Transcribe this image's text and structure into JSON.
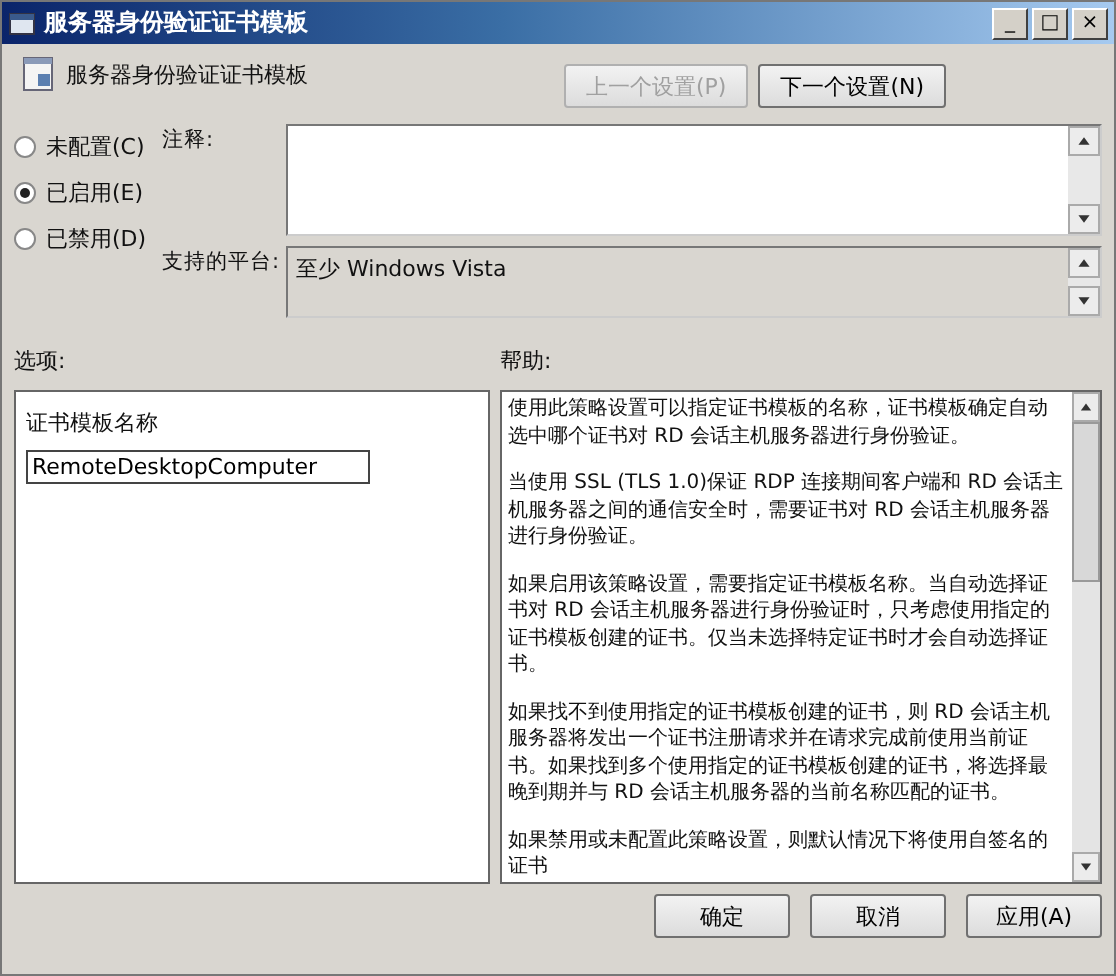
{
  "window": {
    "title": "服务器身份验证证书模板",
    "controls": [
      "_",
      "□",
      "×"
    ]
  },
  "header": {
    "title": "服务器身份验证证书模板"
  },
  "nav_buttons": [
    {
      "label": "上一个设置(P)",
      "disabled": true
    },
    {
      "label": "下一个设置(N)",
      "disabled": false
    }
  ],
  "radios": [
    {
      "label": "未配置(C)",
      "selected": false
    },
    {
      "label": "已启用(E)",
      "selected": true
    },
    {
      "label": "已禁用(D)",
      "selected": false
    }
  ],
  "comment": {
    "label": "注释:"
  },
  "platform": {
    "label": "支持的平台:",
    "value": "至少 Windows Vista"
  },
  "options": {
    "label": "选项:",
    "field_label": "证书模板名称",
    "field_value": "RemoteDesktopComputer"
  },
  "help": {
    "label": "帮助:",
    "paragraphs": [
      "使用此策略设置可以指定证书模板的名称，证书模板确定自动选中哪个证书对 RD 会话主机服务器进行身份验证。",
      "当使用 SSL (TLS 1.0)保证 RDP 连接期间客户端和 RD 会话主机服务器之间的通信安全时，需要证书对 RD 会话主机服务器进行身份验证。",
      "如果启用该策略设置，需要指定证书模板名称。当自动选择证书对 RD 会话主机服务器进行身份验证时，只考虑使用指定的证书模板创建的证书。仅当未选择特定证书时才会自动选择证书。",
      "如果找不到使用指定的证书模板创建的证书，则 RD 会话主机服务器将发出一个证书注册请求并在请求完成前使用当前证书。如果找到多个使用指定的证书模板创建的证书，将选择最晚到期并与 RD 会话主机服务器的当前名称匹配的证书。",
      "如果禁用或未配置此策略设置，则默认情况下将使用自签名的证书"
    ]
  },
  "buttons": [
    "确定",
    "取消",
    "应用(A)"
  ]
}
